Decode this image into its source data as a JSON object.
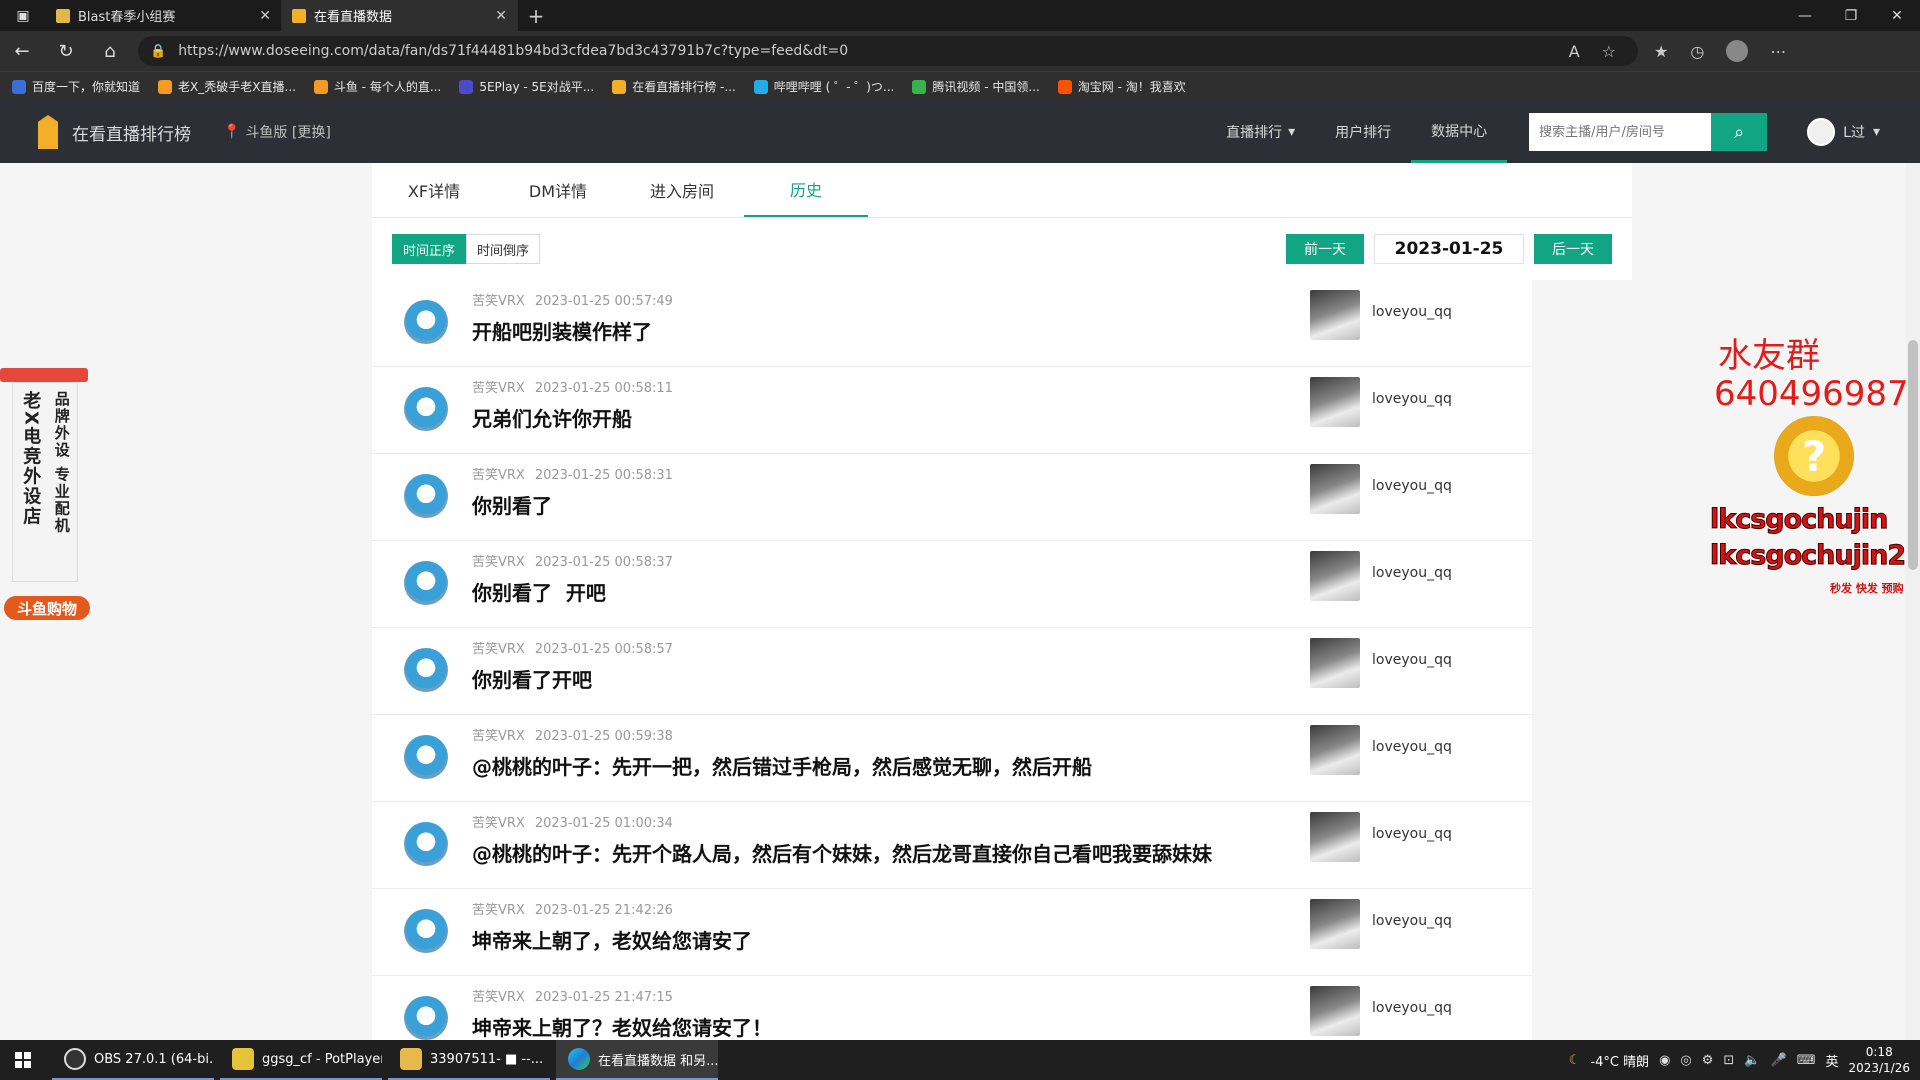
{
  "browser": {
    "tabs": [
      {
        "title": "Blast春季小组赛",
        "active": false
      },
      {
        "title": "在看直播数据",
        "active": true
      }
    ],
    "new_tab": "+",
    "url": "https://www.doseeing.com/data/fan/ds71f44481b94bd3cfdea7bd3c43791b7c?type=feed&dt=0",
    "bookmarks": [
      "百度一下，你就知道",
      "老X_秃破手老X直播...",
      "斗鱼 - 每个人的直...",
      "5EPlay - 5E对战平...",
      "在看直播排行榜 -...",
      "哔哩哔哩 ( ゜- ゜)つ...",
      "腾讯视频 - 中国领...",
      "淘宝网 - 淘！我喜欢"
    ]
  },
  "site": {
    "logo_text": "在看直播排行榜",
    "region": "斗鱼版 [更换]",
    "nav": [
      "直播排行",
      "用户排行",
      "数据中心"
    ],
    "search_placeholder": "搜索主播/用户/房间号",
    "username": "L过"
  },
  "tabs": [
    "XF详情",
    "DM详情",
    "进入房间",
    "历史"
  ],
  "active_tab": "历史",
  "sort": {
    "asc": "时间正序",
    "desc": "时间倒序"
  },
  "date_nav": {
    "prev": "前一天",
    "date": "2023-01-25",
    "next": "后一天"
  },
  "messages": [
    {
      "user": "苦笑VRX",
      "time": "2023-01-25 00:57:49",
      "text": "开船吧别装模作样了",
      "room_user": "loveyou_qq"
    },
    {
      "user": "苦笑VRX",
      "time": "2023-01-25 00:58:11",
      "text": "兄弟们允许你开船",
      "room_user": "loveyou_qq"
    },
    {
      "user": "苦笑VRX",
      "time": "2023-01-25 00:58:31",
      "text": "你别看了",
      "room_user": "loveyou_qq"
    },
    {
      "user": "苦笑VRX",
      "time": "2023-01-25 00:58:37",
      "text": "你别看了  开吧",
      "room_user": "loveyou_qq"
    },
    {
      "user": "苦笑VRX",
      "time": "2023-01-25 00:58:57",
      "text": "你别看了开吧",
      "room_user": "loveyou_qq"
    },
    {
      "user": "苦笑VRX",
      "time": "2023-01-25 00:59:38",
      "text": "@桃桃的叶子：先开一把，然后错过手枪局，然后感觉无聊，然后开船",
      "room_user": "loveyou_qq"
    },
    {
      "user": "苦笑VRX",
      "time": "2023-01-25 01:00:34",
      "text": "@桃桃的叶子：先开个路人局，然后有个妹妹，然后龙哥直接你自己看吧我要舔妹妹",
      "room_user": "loveyou_qq"
    },
    {
      "user": "苦笑VRX",
      "time": "2023-01-25 21:42:26",
      "text": "坤帝来上朝了，老奴给您请安了",
      "room_user": "loveyou_qq"
    },
    {
      "user": "苦笑VRX",
      "time": "2023-01-25 21:47:15",
      "text": "坤帝来上朝了？老奴给您请安了！",
      "room_user": "loveyou_qq"
    }
  ],
  "left_ad": {
    "col1": "老X电竞外设店",
    "col2": "品牌外设 专业配机",
    "buy": "斗鱼购物"
  },
  "right_ad": {
    "line1": "水友群",
    "line2": "640496987",
    "line3": "lkcsgochujin",
    "line4": "lkcsgochujin2",
    "line5": "秒发 快发 预购"
  },
  "taskbar": {
    "apps": [
      "OBS 27.0.1 (64-bi...",
      "ggsg_cf - PotPlayer",
      "33907511- ■ --...",
      "在看直播数据 和另..."
    ],
    "weather": "-4°C  晴朗",
    "ime": "英",
    "time": "0:18",
    "date": "2023/1/26"
  },
  "colors": {
    "accent": "#12a583",
    "header_bg": "#2c3036",
    "ad_red": "#e21b1b"
  }
}
